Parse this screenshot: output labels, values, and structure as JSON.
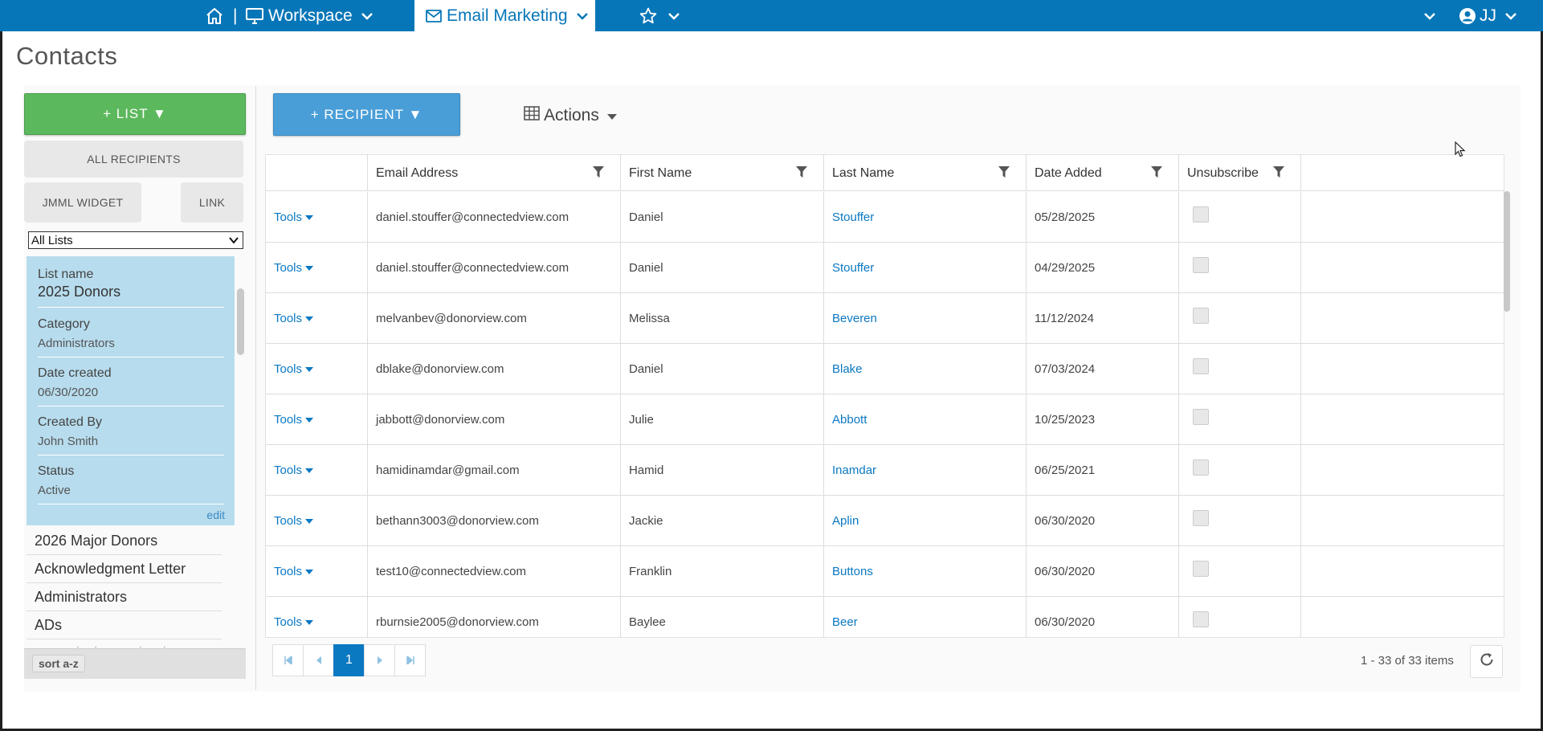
{
  "topbar": {
    "workspace_label": "Workspace",
    "separator": "|",
    "email_marketing_label": "Email Marketing",
    "user_initials": "JJ",
    "bg_color": "#0776b8"
  },
  "page": {
    "title": "Contacts"
  },
  "sidebar": {
    "add_list_label": "+ LIST ▼",
    "all_recipients_label": "ALL RECIPIENTS",
    "jmml_widget_label": "JMML WIDGET",
    "link_label": "LINK",
    "list_filter_value": "All Lists",
    "detail": {
      "list_name_label": "List name",
      "list_name_value": "2025 Donors",
      "category_label": "Category",
      "category_value": "Administrators",
      "date_created_label": "Date created",
      "date_created_value": "06/30/2020",
      "created_by_label": "Created By",
      "created_by_value": "John Smith",
      "status_label": "Status",
      "status_value": "Active",
      "edit_label": "edit"
    },
    "lists": [
      "2026 Major Donors",
      "Acknowledgment Letter",
      "Administrators",
      "ADs",
      "Annual Dinner Thank you"
    ],
    "sort_label": "sort a-z"
  },
  "toolbar": {
    "add_recipient_label": "+ RECIPIENT ▼",
    "actions_label": "Actions"
  },
  "grid": {
    "columns": [
      "",
      "Email Address",
      "First Name",
      "Last Name",
      "Date Added",
      "Unsubscribe"
    ],
    "tools_label": "Tools",
    "rows": [
      {
        "email": "daniel.stouffer@connectedview.com",
        "first": "Daniel",
        "last": "Stouffer",
        "date": "05/28/2025"
      },
      {
        "email": "daniel.stouffer@connectedview.com",
        "first": "Daniel",
        "last": "Stouffer",
        "date": "04/29/2025"
      },
      {
        "email": "melvanbev@donorview.com",
        "first": "Melissa",
        "last": "Beveren",
        "date": "11/12/2024"
      },
      {
        "email": "dblake@donorview.com",
        "first": "Daniel",
        "last": "Blake",
        "date": "07/03/2024"
      },
      {
        "email": "jabbott@donorview.com",
        "first": "Julie",
        "last": "Abbott",
        "date": "10/25/2023"
      },
      {
        "email": "hamidinamdar@gmail.com",
        "first": "Hamid",
        "last": "Inamdar",
        "date": "06/25/2021"
      },
      {
        "email": "bethann3003@donorview.com",
        "first": "Jackie",
        "last": "Aplin",
        "date": "06/30/2020"
      },
      {
        "email": "test10@connectedview.com",
        "first": "Franklin",
        "last": "Buttons",
        "date": "06/30/2020"
      },
      {
        "email": "rburnsie2005@donorview.com",
        "first": "Baylee",
        "last": "Beer",
        "date": "06/30/2020"
      }
    ]
  },
  "pager": {
    "current_page": "1",
    "info": "1 - 33 of 33 items"
  }
}
